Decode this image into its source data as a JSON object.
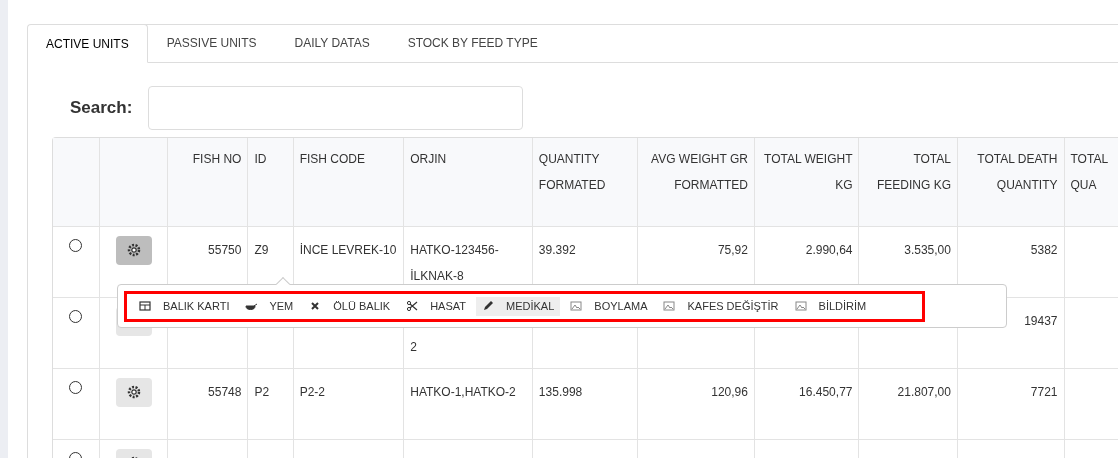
{
  "tabs": [
    {
      "label": "ACTIVE UNITS",
      "selected": true
    },
    {
      "label": "PASSIVE UNITS",
      "selected": false
    },
    {
      "label": "DAILY DATAS",
      "selected": false
    },
    {
      "label": "STOCK BY FEED TYPE",
      "selected": false
    }
  ],
  "search": {
    "label": "Search:"
  },
  "table": {
    "columns": [
      "",
      "",
      "FISH NO",
      "ID",
      "FISH CODE",
      "ORJIN",
      "QUANTITY FORMATED",
      "AVG WEIGHT GR FORMATTED",
      "TOTAL WEIGHT KG",
      "TOTAL FEEDING KG",
      "TOTAL DEATH QUANTITY",
      "TOTAL QUA"
    ],
    "rows": [
      {
        "selected": false,
        "menu_open": true,
        "cells": [
          "",
          "",
          "55750",
          "Z9",
          "İNCE LEVREK-10",
          "HATKO-123456-İLKNAK-8",
          "39.392",
          "75,92",
          "2.990,64",
          "3.535,00",
          "5382",
          ""
        ]
      },
      {
        "selected": false,
        "menu_open": false,
        "first_line_covered": true,
        "cells": [
          "",
          "",
          "",
          "",
          "",
          "2",
          "",
          "",
          "",
          "",
          "19437",
          ""
        ]
      },
      {
        "selected": false,
        "menu_open": false,
        "cells": [
          "",
          "",
          "55748",
          "P2",
          "P2-2",
          "HATKO-1,HATKO-2",
          "135.998",
          "120,96",
          "16.450,77",
          "21.807,00",
          "7721",
          ""
        ]
      },
      {
        "selected": false,
        "menu_open": false,
        "cells": [
          "",
          "",
          "",
          "",
          "",
          "",
          "",
          "",
          "",
          "",
          "",
          ""
        ]
      }
    ]
  },
  "action_menu": {
    "highlighted": true,
    "items": [
      {
        "kind": "table",
        "label": "BALIK KARTI",
        "selected": false
      },
      {
        "kind": "bowl",
        "label": "YEM",
        "selected": false
      },
      {
        "kind": "cross",
        "label": "ÖLÜ BALIK",
        "selected": false
      },
      {
        "kind": "scissors",
        "label": "HASAT",
        "selected": false
      },
      {
        "kind": "pen",
        "label": "MEDİKAL",
        "selected": true
      },
      {
        "kind": "image",
        "label": "BOYLAMA",
        "selected": false
      },
      {
        "kind": "image",
        "label": "KAFES DEĞİŞTİR",
        "selected": false
      },
      {
        "kind": "image",
        "label": "BİLDİRİM",
        "selected": false
      }
    ]
  }
}
